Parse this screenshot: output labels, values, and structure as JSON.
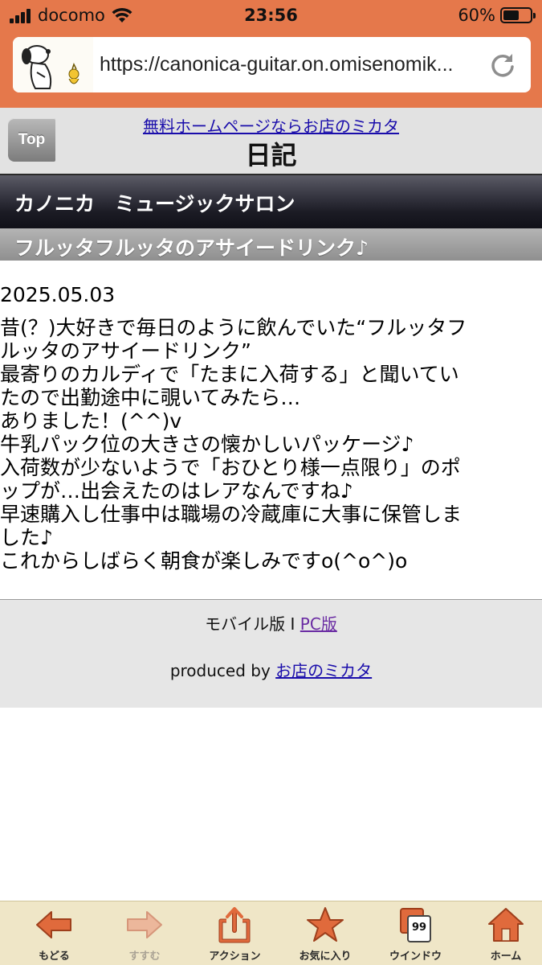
{
  "statusbar": {
    "carrier": "docomo",
    "time": "23:56",
    "battery": "60%"
  },
  "browser": {
    "url": "https://canonica-guitar.on.omisenomik..."
  },
  "header": {
    "top_button": "Top",
    "promo_link": "無料ホームページならお店のミカタ",
    "title": "日記"
  },
  "shop": {
    "name": "カノニカ　ミュージックサロン"
  },
  "entry": {
    "title": "フルッタフルッタのアサイードリンク♪",
    "date": "2025.05.03",
    "lines": [
      "昔(？)大好きで毎日のように飲んでいた“フルッタフ",
      "ルッタのアサイードリンク”",
      "最寄りのカルディで「たまに入荷する」と聞いてい",
      "たので出勤途中に覗いてみたら…",
      "ありました！(^^)v",
      "牛乳パック位の大きさの懐かしいパッケージ♪",
      "入荷数が少ないようで「おひとり様一点限り」のポ",
      "ップが…出会えたのはレアなんですね♪",
      "早速購入し仕事中は職場の冷蔵庫に大事に保管しま",
      "した♪",
      "これからしばらく朝食が楽しみですo(^o^)o"
    ]
  },
  "footer": {
    "mobile_label": "モバイル版 I ",
    "pc_link": "PC版",
    "produced_by": "produced by ",
    "shop_link": "お店のミカタ"
  },
  "toolbar": {
    "back": "もどる",
    "forward": "すすむ",
    "action": "アクション",
    "favorites": "お気に入り",
    "windows": "ウインドウ",
    "windows_count": "99",
    "home": "ホーム"
  },
  "colors": {
    "chrome": "#e5784b",
    "link": "#1a0dab",
    "visited_link": "#6a2ba3",
    "toolbar_bg": "#efe6c7",
    "icon_orange": "#e06a3c"
  }
}
